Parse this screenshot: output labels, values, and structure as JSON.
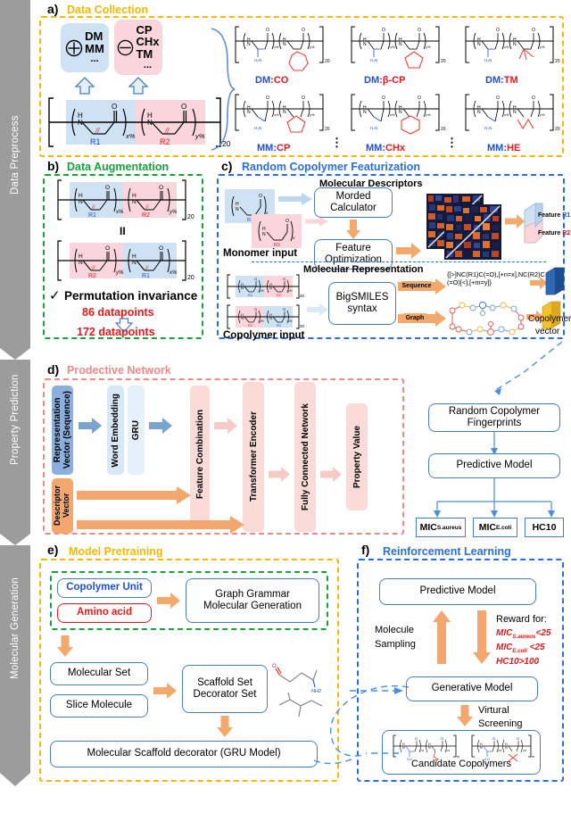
{
  "rail": {
    "segments": [
      {
        "label": "Data Preprocess"
      },
      {
        "label": "Property Prediction"
      },
      {
        "label": "Molecular Generation"
      }
    ]
  },
  "panels": {
    "a": {
      "letter": "a)",
      "title": "Data Collection",
      "color": "#f5b800"
    },
    "b": {
      "letter": "b)",
      "title": "Data Augmentation",
      "color": "#17a33a"
    },
    "c": {
      "letter": "c)",
      "title": "Random Copolymer Featurization",
      "color": "#2b6fd4"
    },
    "d": {
      "letter": "d)",
      "title": "Prodective Network",
      "color": "#f08a86"
    },
    "e": {
      "letter": "e)",
      "title": "Model Pretraining",
      "color": "#f5b800"
    },
    "f": {
      "letter": "f)",
      "title": "Reinforcement Learning",
      "color": "#2b6fd4"
    }
  },
  "panel_a": {
    "cationic_chip": {
      "symbol": "+",
      "lines": [
        "DM",
        "MM"
      ],
      "ellipsis": "..."
    },
    "hydrophobic_chip": {
      "symbol": "-",
      "lines": [
        "CP",
        "CHx",
        "TM"
      ],
      "ellipsis": "..."
    },
    "backbone": {
      "r1": "R1",
      "r2": "R2",
      "x": "x%",
      "y": "y%",
      "dp": "20",
      "n_label": "H",
      "n2_label": "N",
      "o_label": "O"
    },
    "examples": [
      {
        "prefix": "DM:",
        "suffix": "CO",
        "dp": "20"
      },
      {
        "prefix": "DM:",
        "suffix": "β-CP",
        "dp": "20"
      },
      {
        "prefix": "DM:",
        "suffix": "TM",
        "dp": "20"
      },
      {
        "prefix": "MM:",
        "suffix": "CP",
        "dp": "20"
      },
      {
        "prefix": "MM:",
        "suffix": "CHx",
        "dp": "20"
      },
      {
        "prefix": "MM:",
        "suffix": "HE",
        "dp": "20"
      }
    ],
    "vdots": "⋮"
  },
  "panel_b": {
    "top_chain": {
      "left": "R1",
      "right": "R2",
      "leftpct": "x%",
      "rightpct": "y%",
      "dp": "20"
    },
    "bottom_chain": {
      "left": "R2",
      "right": "R1",
      "leftpct": "y%",
      "rightpct": "x%",
      "dp": "20"
    },
    "equals": "II",
    "check": "✓",
    "invariance_label": "Permutation invariance",
    "before": "86 datapoints",
    "after": "172 datapoints"
  },
  "panel_c": {
    "descriptors_title": "Molecular Descriptors",
    "representation_title": "Molecular Representation",
    "monomer_input_label": "Monomer input",
    "copolymer_input_label": "Copolymer input",
    "morded_calculator": "Morded\nCalculator",
    "morded_line1": "Morded",
    "morded_line2": "Calculator",
    "feature_opt_line1": "Feature",
    "feature_opt_line2": "Optimization",
    "bigsmiles_line1": "BigSMILES",
    "bigsmiles_line2": "syntax",
    "sequence_tag": "Sequence",
    "graph_tag": "Graph",
    "bigsmiles_string": "{[>]NC(R1)C(=O),[+n=x],NC(R2)C(=O)[<],[+m=y]}",
    "feature_r1": "Feature R1",
    "feature_r2": "Feature R2",
    "copolymer_vector_line1": "Copolymer",
    "copolymer_vector_line2": "vector",
    "r1": "R1",
    "r2": "R2"
  },
  "panel_d": {
    "representation_vector": "Representation\nVector (Sequence)",
    "representation_vector_l1": "Representation",
    "representation_vector_l2": "Vector (Sequence)",
    "word_embedding": "Word Embedding",
    "gru": "GRU",
    "feature_combination": "Feature Combination",
    "transformer_encoder": "Transformer Encoder",
    "fully_connected": "Fully Connected Network",
    "property_value": "Property Value",
    "descriptor_vector_l1": "Descriptor",
    "descriptor_vector_l2": "Vector",
    "fingerprints_l1": "Random Copolymer",
    "fingerprints_l2": "Fingerprints",
    "predictive_model": "Predictive Model",
    "outputs": [
      {
        "main": "MIC",
        "sub": "S.aureus"
      },
      {
        "main": "MIC",
        "sub": "E.coli"
      },
      {
        "main": "HC10",
        "sub": ""
      }
    ]
  },
  "panel_e": {
    "copolymer_unit": "Copolymer Unit",
    "amino_acid": "Amino acid",
    "graph_grammar_l1": "Graph Grammar",
    "graph_grammar_l2": "Molecular Generation",
    "molecular_set": "Molecular Set",
    "slice_molecule": "Slice Molecule",
    "scaffold_l1": "Scaffold Set",
    "scaffold_l2": "Decorator Set",
    "scaffold_decorator": "Molecular Scaffold decorator (GRU Model)",
    "mol_labels": {
      "o": "O",
      "nh2": "NH2"
    }
  },
  "panel_f": {
    "predictive_model": "Predictive Model",
    "generative_model": "Generative Model",
    "molecule_sampling_l1": "Molecule",
    "molecule_sampling_l2": "Sampling",
    "reward_header": "Reward for:",
    "reward_items": [
      {
        "main": "MIC",
        "sub": "S.aureus",
        "cond": "<25"
      },
      {
        "main": "MIC",
        "sub": "E.coli",
        "cond": " <25"
      },
      {
        "main": "HC10",
        "sub": "",
        "cond": ">100"
      }
    ],
    "virtual_l1": "Virtural",
    "virtual_l2": "Screening",
    "candidates": "Candidate Copolymers"
  },
  "colors": {
    "blue_fill": "#cfe2f3",
    "pink_fill": "#fad6dc",
    "orange_arrow": "#f2a96b",
    "blue_arrow": "#7ba3d0",
    "pink_arrow": "#f9c9c6",
    "rail_gray": "#9c9c9c",
    "red_text": "#e8191b",
    "blue_text": "#1f4fd8",
    "border_blue": "#4a7ebb"
  }
}
